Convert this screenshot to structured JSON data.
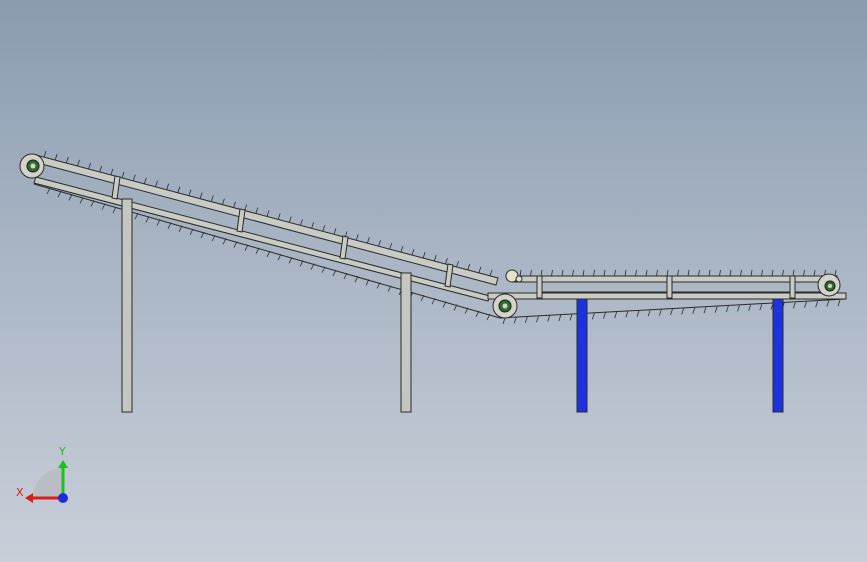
{
  "triad": {
    "x_label": "X",
    "y_label": "Y",
    "x_icon": "x-axis-arrow-icon",
    "y_icon": "y-axis-arrow-icon",
    "z_icon": "z-axis-dot-icon"
  },
  "colors": {
    "background_top": "#8a9bb0",
    "background_bottom": "#c9cfd9",
    "frame": "#c8ccc4",
    "frame_stroke": "#2a2a2a",
    "support_leg_gray": "#c4c7c0",
    "support_leg_blue": "#1c32e0",
    "roller_green": "#2e6e2e",
    "axis_x": "#e01a1a",
    "axis_y": "#1ac21a",
    "axis_z": "#1a2ee0"
  }
}
